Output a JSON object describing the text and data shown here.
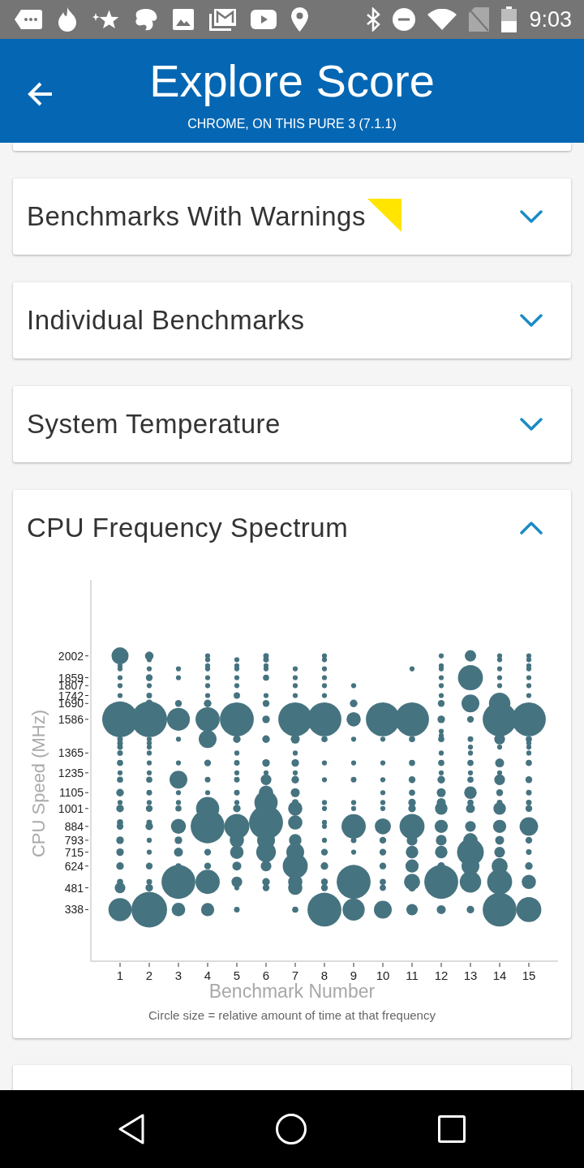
{
  "status_bar": {
    "time": "9:03"
  },
  "app_bar": {
    "title": "Explore Score",
    "subtitle": "CHROME, ON THIS PURE 3 (7.1.1)"
  },
  "cards": [
    {
      "title": "Benchmarks With Warnings",
      "flagged": true,
      "expanded": false
    },
    {
      "title": "Individual Benchmarks",
      "flagged": false,
      "expanded": false
    },
    {
      "title": "System Temperature",
      "flagged": false,
      "expanded": false
    },
    {
      "title": "CPU Frequency Spectrum",
      "flagged": false,
      "expanded": true,
      "chart_data": {
        "type": "scatter",
        "xlabel": "Benchmark Number",
        "ylabel": "CPU Speed (MHz)",
        "xlim": [
          0,
          16
        ],
        "ylim": [
          0,
          2500
        ],
        "xticks": [
          1,
          2,
          3,
          4,
          5,
          6,
          7,
          8,
          9,
          10,
          11,
          12,
          13,
          14,
          15
        ],
        "yticks": [
          338,
          481,
          624,
          715,
          793,
          884,
          1001,
          1105,
          1235,
          1365,
          1586,
          1690,
          1742,
          1807,
          1859,
          2002
        ],
        "x": [
          1,
          1,
          1,
          1,
          1,
          1,
          1,
          1,
          1,
          1,
          1,
          1,
          1,
          1,
          1,
          1,
          1,
          1,
          1,
          1,
          1,
          1,
          1,
          1,
          1,
          2,
          2,
          2,
          2,
          2,
          2,
          2,
          2,
          2,
          2,
          2,
          2,
          2,
          2,
          2,
          2,
          2,
          2,
          2,
          2,
          2,
          2,
          2,
          2,
          2,
          2,
          3,
          3,
          3,
          3,
          3,
          3,
          3,
          3,
          3,
          3,
          3,
          3,
          3,
          3,
          3,
          3,
          4,
          4,
          4,
          4,
          4,
          4,
          4,
          4,
          4,
          4,
          4,
          4,
          4,
          4,
          4,
          4,
          4,
          4,
          4,
          5,
          5,
          5,
          5,
          5,
          5,
          5,
          5,
          5,
          5,
          5,
          5,
          5,
          5,
          5,
          5,
          5,
          5,
          5,
          5,
          5,
          5,
          6,
          6,
          6,
          6,
          6,
          6,
          6,
          6,
          6,
          6,
          6,
          6,
          6,
          6,
          6,
          6,
          6,
          6,
          6,
          6,
          7,
          7,
          7,
          7,
          7,
          7,
          7,
          7,
          7,
          7,
          7,
          7,
          7,
          7,
          7,
          7,
          7,
          7,
          7,
          7,
          8,
          8,
          8,
          8,
          8,
          8,
          8,
          8,
          8,
          8,
          8,
          8,
          8,
          8,
          8,
          8,
          8,
          8,
          8,
          8,
          9,
          9,
          9,
          9,
          9,
          9,
          9,
          9,
          9,
          9,
          9,
          9,
          9,
          10,
          10,
          10,
          10,
          10,
          10,
          10,
          10,
          10,
          10,
          10,
          10,
          10,
          10,
          11,
          11,
          11,
          11,
          11,
          11,
          11,
          11,
          11,
          11,
          11,
          11,
          11,
          11,
          11,
          12,
          12,
          12,
          12,
          12,
          12,
          12,
          12,
          12,
          12,
          12,
          12,
          12,
          12,
          12,
          12,
          12,
          12,
          12,
          12,
          12,
          12,
          12,
          12,
          13,
          13,
          13,
          13,
          13,
          13,
          13,
          13,
          13,
          13,
          13,
          13,
          13,
          13,
          13,
          13,
          13,
          13,
          13,
          14,
          14,
          14,
          14,
          14,
          14,
          14,
          14,
          14,
          14,
          14,
          14,
          14,
          14,
          14,
          14,
          14,
          14,
          14,
          14,
          14,
          15,
          15,
          15,
          15,
          15,
          15,
          15,
          15,
          15,
          15,
          15,
          15,
          15,
          15,
          15,
          15,
          15,
          15,
          15,
          15,
          15,
          15,
          15
        ],
        "series": [
          {
            "color": "#467380",
            "values": [
              2002,
              1937,
              1917,
              1859,
              1807,
              1742,
              1586,
              1456,
              1430,
              1404,
              1365,
              1300,
              1235,
              1190,
              1105,
              1040,
              1001,
              910,
              884,
              793,
              715,
              624,
              520,
              481,
              338,
              2002,
              1977,
              1917,
              1859,
              1807,
              1742,
              1690,
              1586,
              1456,
              1430,
              1404,
              1365,
              1300,
              1235,
              1190,
              1105,
              1040,
              1001,
              910,
              884,
              793,
              715,
              624,
              520,
              481,
              338,
              1917,
              1859,
              1690,
              1586,
              1456,
              1300,
              1190,
              1105,
              1040,
              1001,
              884,
              793,
              715,
              624,
              520,
              338,
              2002,
              1977,
              1937,
              1917,
              1859,
              1807,
              1742,
              1690,
              1586,
              1456,
              1300,
              1190,
              1105,
              1001,
              884,
              715,
              624,
              520,
              338,
              1977,
              1937,
              1917,
              1859,
              1807,
              1742,
              1586,
              1456,
              1365,
              1300,
              1235,
              1190,
              1105,
              1040,
              1001,
              884,
              793,
              715,
              624,
              520,
              481,
              338,
              2002,
              1977,
              1937,
              1917,
              1859,
              1742,
              1690,
              1586,
              1456,
              1300,
              1235,
              1190,
              1105,
              1040,
              910,
              793,
              715,
              624,
              520,
              481,
              1917,
              1859,
              1807,
              1742,
              1586,
              1456,
              1365,
              1300,
              1235,
              1190,
              1105,
              1040,
              1001,
              910,
              793,
              715,
              624,
              520,
              481,
              338,
              2002,
              1977,
              1917,
              1859,
              1807,
              1742,
              1586,
              1456,
              1300,
              1190,
              1040,
              1001,
              910,
              884,
              793,
              715,
              624,
              520,
              481,
              338,
              1807,
              1690,
              1586,
              1456,
              1300,
              1190,
              1040,
              1001,
              884,
              793,
              715,
              520,
              338,
              1586,
              1456,
              1300,
              1190,
              1105,
              1040,
              1001,
              884,
              793,
              715,
              624,
              520,
              481,
              338,
              1917,
              1586,
              1456,
              1300,
              1190,
              1105,
              1040,
              1001,
              884,
              793,
              715,
              624,
              520,
              481,
              338,
              2002,
              1937,
              1917,
              1859,
              1807,
              1742,
              1690,
              1586,
              1508,
              1479,
              1456,
              1365,
              1300,
              1235,
              1190,
              1105,
              1040,
              1001,
              884,
              793,
              715,
              624,
              520,
              338,
              2002,
              1859,
              1690,
              1586,
              1456,
              1404,
              1365,
              1300,
              1235,
              1190,
              1105,
              1040,
              1001,
              884,
              793,
              715,
              624,
              520,
              338,
              2002,
              1977,
              1917,
              1859,
              1807,
              1690,
              1586,
              1456,
              1404,
              1300,
              1235,
              1190,
              1105,
              1040,
              1001,
              884,
              793,
              715,
              624,
              520,
              338,
              2002,
              1977,
              1937,
              1917,
              1859,
              1807,
              1742,
              1586,
              1456,
              1430,
              1404,
              1365,
              1300,
              1190,
              1105,
              1040,
              1001,
              884,
              793,
              715,
              624,
              520,
              338
            ],
            "sizes": [
              0.23,
              0.02,
              0.02,
              0.02,
              0.02,
              0.02,
              1,
              0.025,
              0.025,
              0.025,
              0.025,
              0.03,
              0.02,
              0.03,
              0.045,
              0.02,
              0.045,
              0.03,
              0.036,
              0.045,
              0.045,
              0.045,
              0.03,
              0.09,
              0.423,
              0.058,
              0.02,
              0.02,
              0.036,
              0.02,
              0.025,
              0.045,
              1,
              0.02,
              0.02,
              0.02,
              0.02,
              0.02,
              0.02,
              0.03,
              0.025,
              0.02,
              0.036,
              0.025,
              0.045,
              0.02,
              0.02,
              0.036,
              0.025,
              0.045,
              1,
              0.02,
              0.02,
              0.036,
              0.41,
              0.02,
              0.02,
              0.25,
              0.02,
              0.02,
              0.03,
              0.176,
              0.045,
              0.063,
              0.025,
              0.903,
              0.144,
              0.02,
              0.02,
              0.02,
              0.02,
              0.02,
              0.02,
              0.02,
              0.045,
              0.462,
              0.25,
              0.036,
              0.025,
              0.02,
              0.423,
              0.903,
              0.036,
              0.036,
              0.462,
              0.137,
              0.02,
              0.02,
              0.02,
              0.02,
              0.02,
              0.032,
              0.903,
              0.045,
              0.02,
              0.025,
              0.02,
              0.025,
              0.025,
              0.02,
              0.045,
              0.49,
              0.16,
              0.144,
              0.063,
              0.09,
              0.02,
              0.025,
              0.025,
              0.025,
              0.02,
              0.02,
              0.03,
              0.02,
              0.036,
              0.045,
              0.045,
              0.045,
              0.02,
              0.09,
              0.16,
              0.423,
              0.903,
              0.25,
              0.303,
              0.09,
              0.045,
              0.036,
              0.02,
              0.02,
              0.02,
              0.02,
              0.903,
              0.063,
              0.02,
              0.045,
              0.02,
              0.045,
              0.063,
              0.036,
              0.16,
              0.16,
              0.123,
              0.25,
              0.49,
              0.16,
              0.16,
              0.03,
              0.02,
              0.02,
              0.02,
              0.02,
              0.02,
              0.02,
              0.903,
              0.03,
              0.02,
              0.02,
              0.02,
              0.02,
              0.02,
              0.02,
              0.02,
              0.036,
              0.045,
              0.036,
              0.036,
              0.903,
              0.02,
              0.045,
              0.16,
              0.02,
              0.02,
              0.025,
              0.02,
              0.02,
              0.462,
              0.025,
              0.02,
              0.903,
              0.384,
              0.903,
              0.02,
              0.02,
              0.02,
              0.02,
              0.02,
              0.02,
              0.203,
              0.036,
              0.036,
              0.036,
              0.03,
              0.03,
              0.25,
              0.02,
              0.903,
              0.03,
              0.03,
              0.036,
              0.03,
              0.045,
              0.045,
              0.49,
              0.09,
              0.123,
              0.137,
              0.203,
              0.045,
              0.102,
              0.02,
              0.02,
              0.02,
              0.02,
              0.02,
              0.02,
              0.036,
              0.045,
              0.02,
              0.02,
              0.03,
              0.02,
              0.03,
              0.02,
              0.045,
              0.063,
              0.063,
              0.123,
              0.137,
              0.09,
              0.123,
              0.045,
              0.903,
              0.063,
              0.102,
              0.49,
              0.25,
              0.036,
              0.025,
              0.02,
              0.02,
              0.03,
              0.02,
              0.03,
              0.123,
              0.03,
              0.063,
              0.09,
              0.16,
              0.563,
              0.25,
              0.36,
              0.045,
              0.02,
              0.02,
              0.02,
              0.02,
              0.02,
              0.36,
              0.903,
              0.09,
              0.02,
              0.063,
              0.02,
              0.09,
              0.036,
              0.025,
              0.123,
              0.137,
              0.063,
              0.09,
              0.203,
              0.49,
              0.903,
              0.02,
              0.02,
              0.02,
              0.02,
              0.02,
              0.02,
              0.02,
              0.903,
              0.03,
              0.02,
              0.02,
              0.02,
              0.03,
              0.036,
              0.025,
              0.025,
              0.036,
              0.27,
              0.036,
              0.025,
              0.045,
              0.16,
              0.49
            ]
          }
        ]
      },
      "caption": "Circle size = relative amount of time at that frequency"
    }
  ]
}
